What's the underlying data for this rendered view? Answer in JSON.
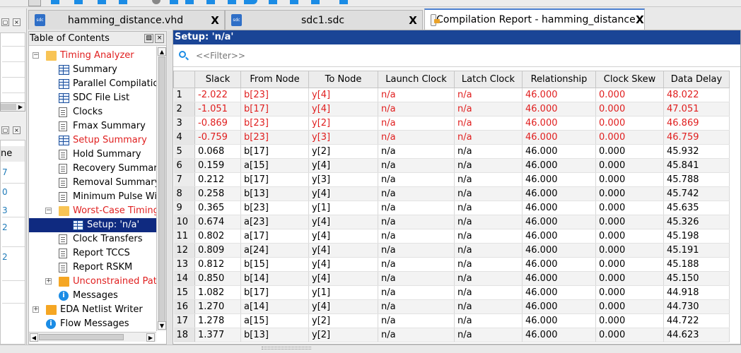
{
  "toolbar": {
    "colors": {
      "accent": "#1a4596",
      "icon_blue": "#1b8ce5"
    }
  },
  "tabs": [
    {
      "label": "hamming_distance.vhd",
      "icon": "sdc",
      "active": false
    },
    {
      "label": "sdc1.sdc",
      "icon": "sdc",
      "active": false
    },
    {
      "label": "Compilation Report - hamming_distance",
      "icon": "report",
      "active": true
    }
  ],
  "tab_close_glyph": "X",
  "tab_icon_text": "sdc",
  "left_panel": {
    "header_partial": "ne",
    "link_glyphs": [
      "7",
      "0",
      "3",
      "2",
      "2"
    ]
  },
  "toc": {
    "title": "Table of Contents",
    "items": [
      {
        "label": "Timing Analyzer",
        "icon": "folder-open",
        "color": "red",
        "level": 0
      },
      {
        "label": "Summary",
        "icon": "table",
        "level": 1
      },
      {
        "label": "Parallel Compilation",
        "icon": "table",
        "level": 1
      },
      {
        "label": "SDC File List",
        "icon": "table",
        "level": 1
      },
      {
        "label": "Clocks",
        "icon": "doc",
        "level": 1
      },
      {
        "label": "Fmax Summary",
        "icon": "doc",
        "level": 1
      },
      {
        "label": "Setup Summary",
        "icon": "table",
        "color": "red",
        "level": 1
      },
      {
        "label": "Hold Summary",
        "icon": "doc",
        "level": 1
      },
      {
        "label": "Recovery Summary",
        "icon": "doc",
        "level": 1
      },
      {
        "label": "Removal Summary",
        "icon": "doc",
        "level": 1
      },
      {
        "label": "Minimum Pulse Width",
        "icon": "doc",
        "level": 1
      },
      {
        "label": "Worst-Case Timing",
        "icon": "folder-open",
        "color": "red",
        "level": 1
      },
      {
        "label": "Setup: 'n/a'",
        "icon": "table",
        "level": 2,
        "selected": true
      },
      {
        "label": "Clock Transfers",
        "icon": "doc",
        "level": 1
      },
      {
        "label": "Report TCCS",
        "icon": "doc",
        "level": 1
      },
      {
        "label": "Report RSKM",
        "icon": "doc",
        "level": 1
      },
      {
        "label": "Unconstrained Paths",
        "icon": "folder",
        "color": "red",
        "level": 1
      },
      {
        "label": "Messages",
        "icon": "info",
        "level": 1
      },
      {
        "label": "EDA Netlist Writer",
        "icon": "folder",
        "level": 0
      },
      {
        "label": "Flow Messages",
        "icon": "info",
        "level": 0
      }
    ]
  },
  "report": {
    "title": "Setup: 'n/a'",
    "filter_placeholder": "<<Filter>>",
    "columns": [
      "Slack",
      "From Node",
      "To Node",
      "Launch Clock",
      "Latch Clock",
      "Relationship",
      "Clock Skew",
      "Data Delay"
    ],
    "rows": [
      [
        "1",
        "-2.022",
        "b[23]",
        "y[4]",
        "n/a",
        "n/a",
        "46.000",
        "0.000",
        "48.022"
      ],
      [
        "2",
        "-1.051",
        "b[17]",
        "y[4]",
        "n/a",
        "n/a",
        "46.000",
        "0.000",
        "47.051"
      ],
      [
        "3",
        "-0.869",
        "b[23]",
        "y[2]",
        "n/a",
        "n/a",
        "46.000",
        "0.000",
        "46.869"
      ],
      [
        "4",
        "-0.759",
        "b[23]",
        "y[3]",
        "n/a",
        "n/a",
        "46.000",
        "0.000",
        "46.759"
      ],
      [
        "5",
        "0.068",
        "b[17]",
        "y[2]",
        "n/a",
        "n/a",
        "46.000",
        "0.000",
        "45.932"
      ],
      [
        "6",
        "0.159",
        "a[15]",
        "y[4]",
        "n/a",
        "n/a",
        "46.000",
        "0.000",
        "45.841"
      ],
      [
        "7",
        "0.212",
        "b[17]",
        "y[3]",
        "n/a",
        "n/a",
        "46.000",
        "0.000",
        "45.788"
      ],
      [
        "8",
        "0.258",
        "b[13]",
        "y[4]",
        "n/a",
        "n/a",
        "46.000",
        "0.000",
        "45.742"
      ],
      [
        "9",
        "0.365",
        "b[23]",
        "y[1]",
        "n/a",
        "n/a",
        "46.000",
        "0.000",
        "45.635"
      ],
      [
        "10",
        "0.674",
        "a[23]",
        "y[4]",
        "n/a",
        "n/a",
        "46.000",
        "0.000",
        "45.326"
      ],
      [
        "11",
        "0.802",
        "a[17]",
        "y[4]",
        "n/a",
        "n/a",
        "46.000",
        "0.000",
        "45.198"
      ],
      [
        "12",
        "0.809",
        "a[24]",
        "y[4]",
        "n/a",
        "n/a",
        "46.000",
        "0.000",
        "45.191"
      ],
      [
        "13",
        "0.812",
        "b[15]",
        "y[4]",
        "n/a",
        "n/a",
        "46.000",
        "0.000",
        "45.188"
      ],
      [
        "14",
        "0.850",
        "b[14]",
        "y[4]",
        "n/a",
        "n/a",
        "46.000",
        "0.000",
        "45.150"
      ],
      [
        "15",
        "1.082",
        "b[17]",
        "y[1]",
        "n/a",
        "n/a",
        "46.000",
        "0.000",
        "44.918"
      ],
      [
        "16",
        "1.270",
        "a[14]",
        "y[4]",
        "n/a",
        "n/a",
        "46.000",
        "0.000",
        "44.730"
      ],
      [
        "17",
        "1.278",
        "a[15]",
        "y[2]",
        "n/a",
        "n/a",
        "46.000",
        "0.000",
        "44.722"
      ],
      [
        "18",
        "1.377",
        "b[13]",
        "y[2]",
        "n/a",
        "n/a",
        "46.000",
        "0.000",
        "44.623"
      ]
    ],
    "negative_slack_color": "#e01e1e"
  }
}
